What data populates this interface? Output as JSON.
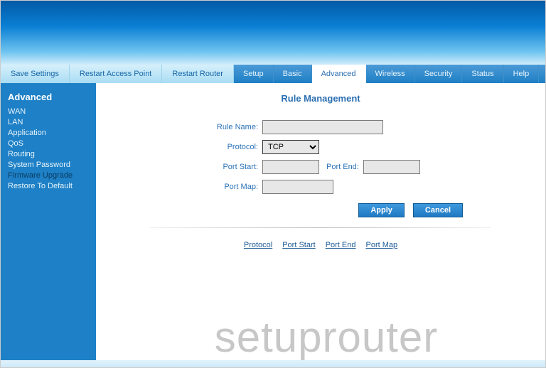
{
  "nav": {
    "left": [
      {
        "label": "Save Settings"
      },
      {
        "label": "Restart Access Point"
      },
      {
        "label": "Restart Router"
      }
    ],
    "right": [
      {
        "label": "Setup",
        "active": false
      },
      {
        "label": "Basic",
        "active": false
      },
      {
        "label": "Advanced",
        "active": true
      },
      {
        "label": "Wireless",
        "active": false
      },
      {
        "label": "Security",
        "active": false
      },
      {
        "label": "Status",
        "active": false
      },
      {
        "label": "Help",
        "active": false
      }
    ]
  },
  "sidebar": {
    "heading": "Advanced",
    "items": [
      {
        "label": "WAN",
        "active": false
      },
      {
        "label": "LAN",
        "active": false
      },
      {
        "label": "Application",
        "active": false
      },
      {
        "label": "QoS",
        "active": false
      },
      {
        "label": "Routing",
        "active": false
      },
      {
        "label": "System Password",
        "active": false
      },
      {
        "label": "Firmware Upgrade",
        "active": true
      },
      {
        "label": "Restore To Default",
        "active": false
      }
    ]
  },
  "page": {
    "title": "Rule Management",
    "labels": {
      "rule_name": "Rule Name:",
      "protocol": "Protocol:",
      "port_start": "Port Start:",
      "port_end": "Port End:",
      "port_map": "Port Map:"
    },
    "values": {
      "rule_name": "",
      "protocol": "TCP",
      "port_start": "",
      "port_end": "",
      "port_map": ""
    },
    "buttons": {
      "apply": "Apply",
      "cancel": "Cancel"
    },
    "columns": [
      "Protocol",
      "Port Start",
      "Port End",
      "Port Map"
    ]
  },
  "watermark": "setuprouter"
}
